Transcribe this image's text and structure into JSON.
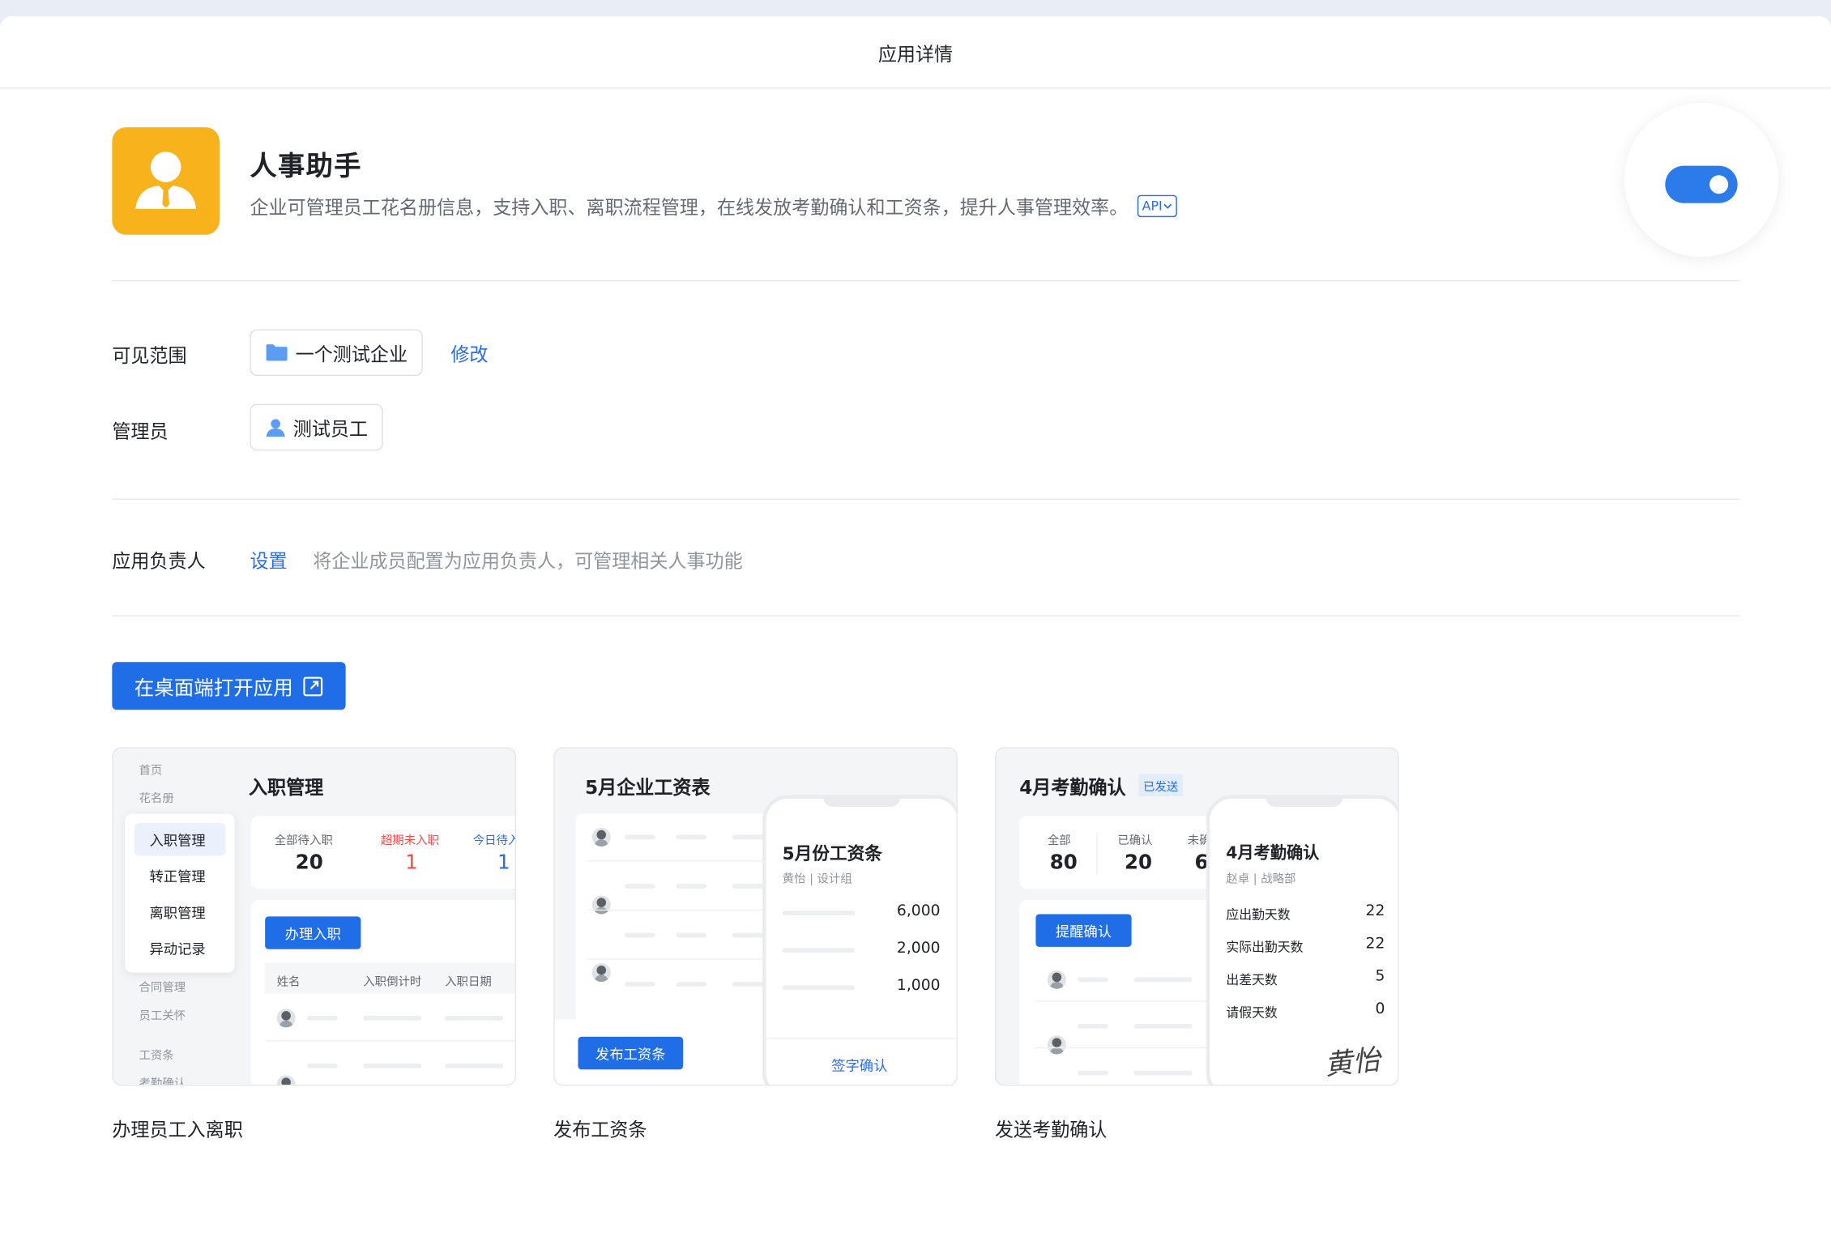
{
  "header": {
    "title": "应用详情"
  },
  "app": {
    "name": "人事助手",
    "description": "企业可管理员工花名册信息，支持入职、离职流程管理，在线发放考勤确认和工资条，提升人事管理效率。",
    "api_tag": "API",
    "enabled": true,
    "icon": "user-icon",
    "icon_color": "#f8b31c"
  },
  "visibility": {
    "label": "可见范围",
    "value": "一个测试企业",
    "edit": "修改"
  },
  "admin": {
    "label": "管理员",
    "value": "测试员工"
  },
  "owner": {
    "label": "应用负责人",
    "action": "设置",
    "hint": "将企业成员配置为应用负责人，可管理相关人事功能"
  },
  "open_button": {
    "label": "在桌面端打开应用"
  },
  "cards": [
    {
      "caption": "办理员工入离职",
      "title": "入职管理",
      "nav_top": [
        "首页",
        "花名册"
      ],
      "menu": [
        "入职管理",
        "转正管理",
        "离职管理",
        "异动记录"
      ],
      "nav_bottom": [
        "合同管理",
        "员工关怀",
        "工资条",
        "考勤确认"
      ],
      "stats": [
        {
          "label": "全部待入职",
          "value": "20"
        },
        {
          "label": "超期未入职",
          "value": "1"
        },
        {
          "label": "今日待入",
          "value": "1"
        }
      ],
      "button": "办理入职",
      "columns": [
        "姓名",
        "入职倒计时",
        "入职日期"
      ]
    },
    {
      "caption": "发布工资条",
      "title": "5月企业工资表",
      "button": "发布工资条",
      "phone_title": "5月份工资条",
      "phone_sub": "黄怡 | 设计组",
      "amounts": [
        "6,000",
        "2,000",
        "1,000"
      ],
      "phone_action": "签字确认"
    },
    {
      "caption": "发送考勤确认",
      "title": "4月考勤确认",
      "badge": "已发送",
      "stats": [
        {
          "label": "全部",
          "value": "80"
        },
        {
          "label": "已确认",
          "value": "20"
        },
        {
          "label": "未确",
          "value": "6"
        }
      ],
      "button": "提醒确认",
      "phone_title": "4月考勤确认",
      "phone_sub": "赵卓 | 战略部",
      "rows": [
        {
          "label": "应出勤天数",
          "value": "22"
        },
        {
          "label": "实际出勤天数",
          "value": "22"
        },
        {
          "label": "出差天数",
          "value": "5"
        },
        {
          "label": "请假天数",
          "value": "0"
        }
      ],
      "signature": "黄怡"
    }
  ],
  "colors": {
    "accent": "#1f6ee8",
    "link": "#2b6de6",
    "warning": "#f54a45"
  }
}
